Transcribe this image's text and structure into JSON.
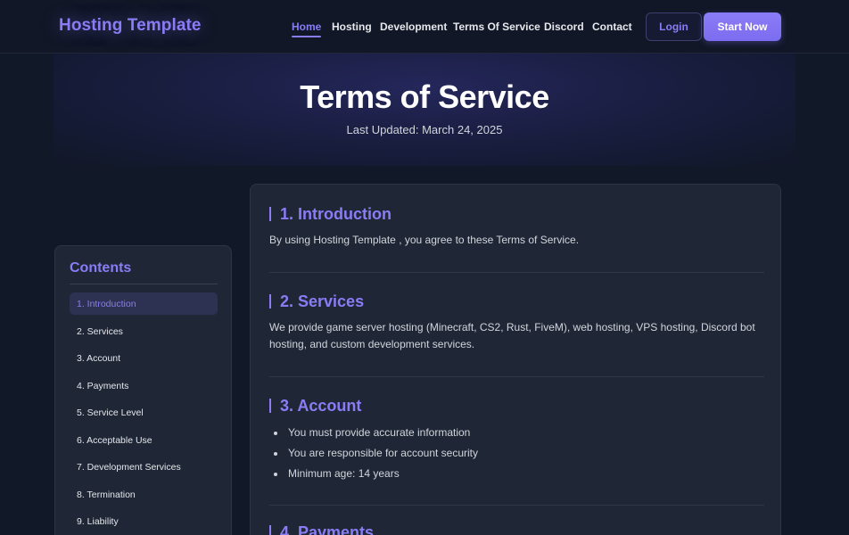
{
  "brand": "Hosting Template",
  "nav": [
    {
      "label": "Home",
      "active": true
    },
    {
      "label": "Hosting",
      "active": false
    },
    {
      "label": "Development",
      "active": false
    },
    {
      "label": "Terms Of Service",
      "active": false
    },
    {
      "label": "Discord",
      "active": false
    },
    {
      "label": "Contact",
      "active": false
    }
  ],
  "buttons": {
    "login": "Login",
    "start": "Start Now"
  },
  "hero": {
    "title": "Terms of Service",
    "subtitle": "Last Updated: March 24, 2025"
  },
  "toc": {
    "title": "Contents",
    "items": [
      "1. Introduction",
      "2. Services",
      "3. Account",
      "4. Payments",
      "5. Service Level",
      "6. Acceptable Use",
      "7. Development Services",
      "8. Termination",
      "9. Liability"
    ]
  },
  "sections": [
    {
      "heading": "1. Introduction",
      "text": "By using Hosting Template , you agree to these Terms of Service."
    },
    {
      "heading": "2. Services",
      "text": "We provide game server hosting (Minecraft, CS2, Rust, FiveM), web hosting, VPS hosting, Discord bot hosting, and custom development services."
    },
    {
      "heading": "3. Account",
      "bullets": [
        "You must provide accurate information",
        "You are responsible for account security",
        "Minimum age: 14 years"
      ]
    },
    {
      "heading": "4. Payments"
    }
  ],
  "colors": {
    "accent": "#8b7cf6",
    "background": "#111827",
    "card": "#1f2737"
  }
}
